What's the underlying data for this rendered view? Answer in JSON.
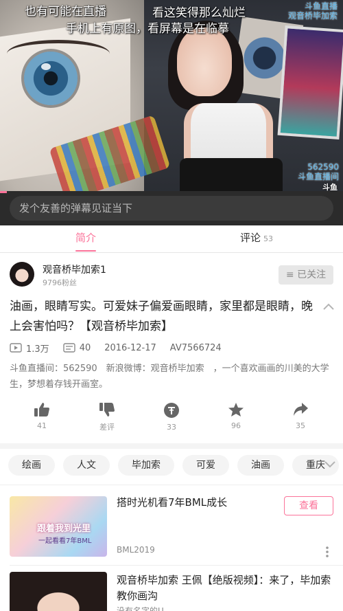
{
  "player": {
    "danmu": [
      "也有可能在直播",
      "看这笑得那么灿烂",
      "手机上有原图，看屏幕是在临摹"
    ],
    "watermark_top": [
      "斗鱼直播",
      "观音桥毕加索"
    ],
    "watermark_room": [
      "562590",
      "斗鱼直播间"
    ],
    "corner_logo": "斗鱼",
    "progress_fraction": 0.02
  },
  "comment_bar": {
    "placeholder": "发个友善的弹幕见证当下"
  },
  "tabs": {
    "intro": "简介",
    "comments": "评论",
    "comments_count": "53"
  },
  "uploader": {
    "name": "观音桥毕加索1",
    "fans": "9796粉丝",
    "follow_label": "已关注"
  },
  "video": {
    "title": "油画，眼睛写实。可爱妹子偏爱画眼睛，家里都是眼睛，晚上会害怕吗？【观音桥毕加索】",
    "plays": "1.3万",
    "danmaku_count": "40",
    "date": "2016-12-17",
    "av": "AV7566724",
    "description": "斗鱼直播间：562590　新浪微博：观音桥毕加索　，一个喜欢画画的川美的大学生，梦想着存钱开画室。"
  },
  "actions": {
    "like": "41",
    "dislike": "差评",
    "coin": "33",
    "favorite": "96",
    "share": "35"
  },
  "tags": [
    "绘画",
    "人文",
    "毕加索",
    "可爱",
    "油画",
    "重庆"
  ],
  "related": [
    {
      "title": "搭时光机看7年BML成长",
      "uploader": "BML2019",
      "action": "查看",
      "thumb_text": "跟着我到光里",
      "thumb_sub": "一起看看7年BML"
    },
    {
      "title": "观音桥毕加索 王佩【绝版视频】：来了，毕加索教你画沟",
      "uploader": "没有名字的U"
    }
  ],
  "colors": {
    "accent": "#fb7299",
    "dark_bar": "#2b2b2b",
    "muted": "#999999"
  }
}
